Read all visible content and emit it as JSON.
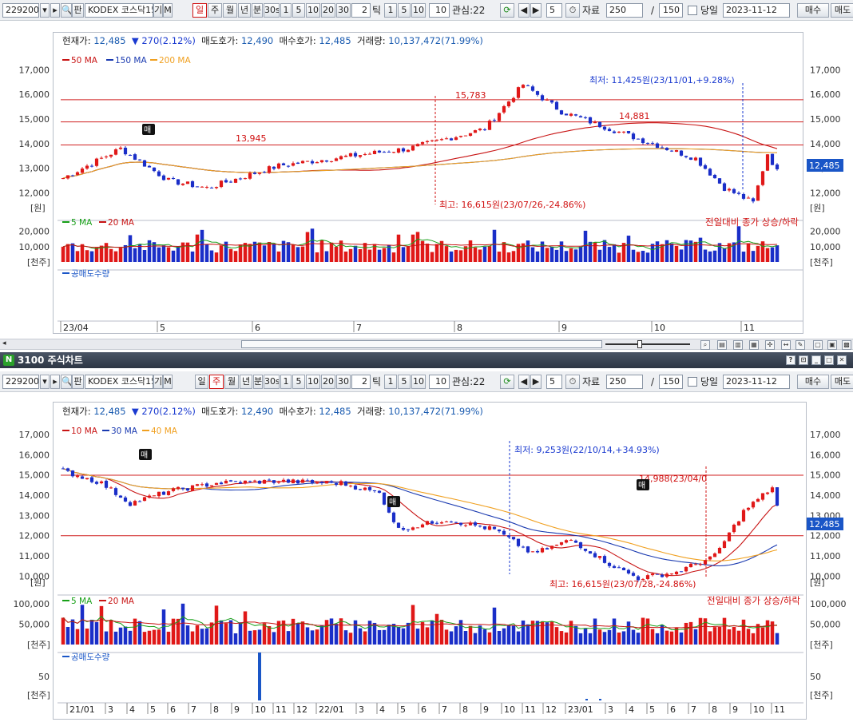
{
  "toolbar": {
    "code": "229200",
    "name": "KODEX 코스닥15",
    "gi": "기",
    "m": "M",
    "periods": [
      "일",
      "주",
      "월",
      "년",
      "분"
    ],
    "interval": "30s",
    "intervals": [
      "1",
      "5",
      "10",
      "20",
      "30"
    ],
    "tick_value": "2",
    "tick_label": "틱",
    "tick_intervals": [
      "1",
      "5",
      "10"
    ],
    "tick_ten": "10",
    "watch_label": "관심:22",
    "count_value": "5",
    "data_label": "자료",
    "data_count": "250",
    "slash": "/",
    "total_150": "150",
    "today_label": "당일",
    "date": "2023-11-12",
    "buy": "매수",
    "sell": "매도"
  },
  "chart1": {
    "info": {
      "price_lbl": "현재가:",
      "price": "12,485",
      "change": "▼ 270(2.12%)",
      "ask_lbl": "매도호가:",
      "ask": "12,490",
      "bid_lbl": "매수호가:",
      "bid": "12,485",
      "vol_lbl": "거래량:",
      "vol": "10,137,472(71.99%)"
    },
    "ma_legend": [
      "50 MA",
      "150 MA",
      "200 MA"
    ],
    "vol_legend": [
      "5 MA",
      "20 MA"
    ],
    "vol_note": "전일대비 종가 상승/하락",
    "short_legend": "공매도수량",
    "y_ticks": [
      "17,000",
      "16,000",
      "15,000",
      "14,000",
      "13,000",
      "12,000"
    ],
    "unit": "[원]",
    "vol_ticks": [
      "20,000",
      "10,000"
    ],
    "vol_unit": "[천주]",
    "x_ticks": [
      "23/04",
      "5",
      "6",
      "7",
      "8",
      "9",
      "10",
      "11"
    ],
    "price_tag": "12,485",
    "ann_low": "최저: 11,425원(23/11/01,+9.28%)",
    "ann_high": "최고: 16,615원(23/07/26,-24.86%)",
    "ann_15783": "15,783",
    "ann_14881": "14,881",
    "ann_13945": "13,945",
    "marker": "매"
  },
  "chart2": {
    "title": "3100 주식차트",
    "info": {
      "price_lbl": "현재가:",
      "price": "12,485",
      "change": "▼ 270(2.12%)",
      "ask_lbl": "매도호가:",
      "ask": "12,490",
      "bid_lbl": "매수호가:",
      "bid": "12,485",
      "vol_lbl": "거래량:",
      "vol": "10,137,472(71.99%)"
    },
    "ma_legend": [
      "10 MA",
      "30 MA",
      "40 MA"
    ],
    "vol_legend": [
      "5 MA",
      "20 MA"
    ],
    "vol_note": "전일대비 종가 상승/하락",
    "short_legend": "공매도수량",
    "y_ticks": [
      "17,000",
      "16,000",
      "15,000",
      "14,000",
      "13,000",
      "12,000",
      "11,000",
      "10,000"
    ],
    "unit": "[원]",
    "vol_ticks": [
      "100,000",
      "50,000"
    ],
    "vol_unit": "[천주]",
    "short_ticks": [
      "50"
    ],
    "x_ticks": [
      "21/01",
      "3",
      "4",
      "5",
      "6",
      "7",
      "8",
      "9",
      "10",
      "11",
      "12",
      "22/01",
      "3",
      "4",
      "5",
      "6",
      "7",
      "8",
      "9",
      "10",
      "11",
      "12",
      "23/01",
      "3",
      "4",
      "5",
      "6",
      "7",
      "8",
      "9",
      "10",
      "11"
    ],
    "price_tag": "12,485",
    "ann_low": "최저: 9,253원(22/10/14,+34.93%)",
    "ann_high": "최고: 16,615원(23/07/28,-24.86%)",
    "ann_14988": "14,988(23/04/0",
    "marker": "매"
  },
  "colors": {
    "up": "#e01818",
    "down": "#1a2ec8",
    "ma1": "#c81414",
    "ma2": "#1a3ab0",
    "ma3": "#f0a020",
    "accent": "#1a56c7"
  }
}
